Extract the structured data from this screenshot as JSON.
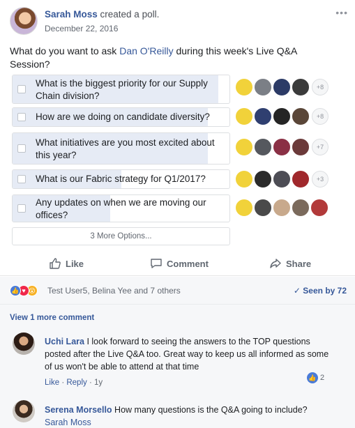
{
  "post": {
    "author": "Sarah Moss",
    "action": " created a poll.",
    "date": "December 22, 2016",
    "more_icon": "ellipsis-icon",
    "question_before": "What do you want to ask ",
    "question_mention": "Dan O'Reilly",
    "question_after": " during this week's Live Q&A Session?"
  },
  "poll": {
    "options": [
      {
        "text": "What is the biggest priority for our Supply Chain division?",
        "extra_count": "+8",
        "vote_share": 0.95
      },
      {
        "text": "How are we doing on candidate diversity?",
        "extra_count": "+8",
        "vote_share": 0.9
      },
      {
        "text": "What initiatives are you most excited about this year?",
        "extra_count": "+7",
        "vote_share": 0.9
      },
      {
        "text": "What is our Fabric strategy for Q1/2017?",
        "extra_count": "+3",
        "vote_share": 0.5
      },
      {
        "text": "Any updates on when we are moving our offices?",
        "extra_count": "",
        "vote_share": 0.45
      }
    ],
    "more_options": "3 More Options..."
  },
  "actions": {
    "like": "Like",
    "comment": "Comment",
    "share": "Share"
  },
  "reactions": {
    "icons": [
      "like-reaction-icon",
      "love-reaction-icon",
      "wow-reaction-icon"
    ],
    "summary": "Test User5, Belina Yee and 7 others",
    "seen": "Seen by 72",
    "colors": {
      "like": "#4a7bd8",
      "love": "#f0284a",
      "wow": "#f7b125"
    }
  },
  "comments": {
    "view_more": "View 1 more comment",
    "items": [
      {
        "author": "Uchi Lara",
        "text": " I look forward to seeing the answers to the TOP questions posted after the Live Q&A too. Great way to keep us all informed as some of us won't be able to attend at that time",
        "like": "Like",
        "reply": "Reply",
        "age": "1y",
        "reaction_count": "2"
      },
      {
        "author": "Serena Morsello",
        "text": " How many questions is the Q&A going to include? ",
        "mention": "Sarah Moss"
      }
    ]
  },
  "accent_color": "#365899"
}
